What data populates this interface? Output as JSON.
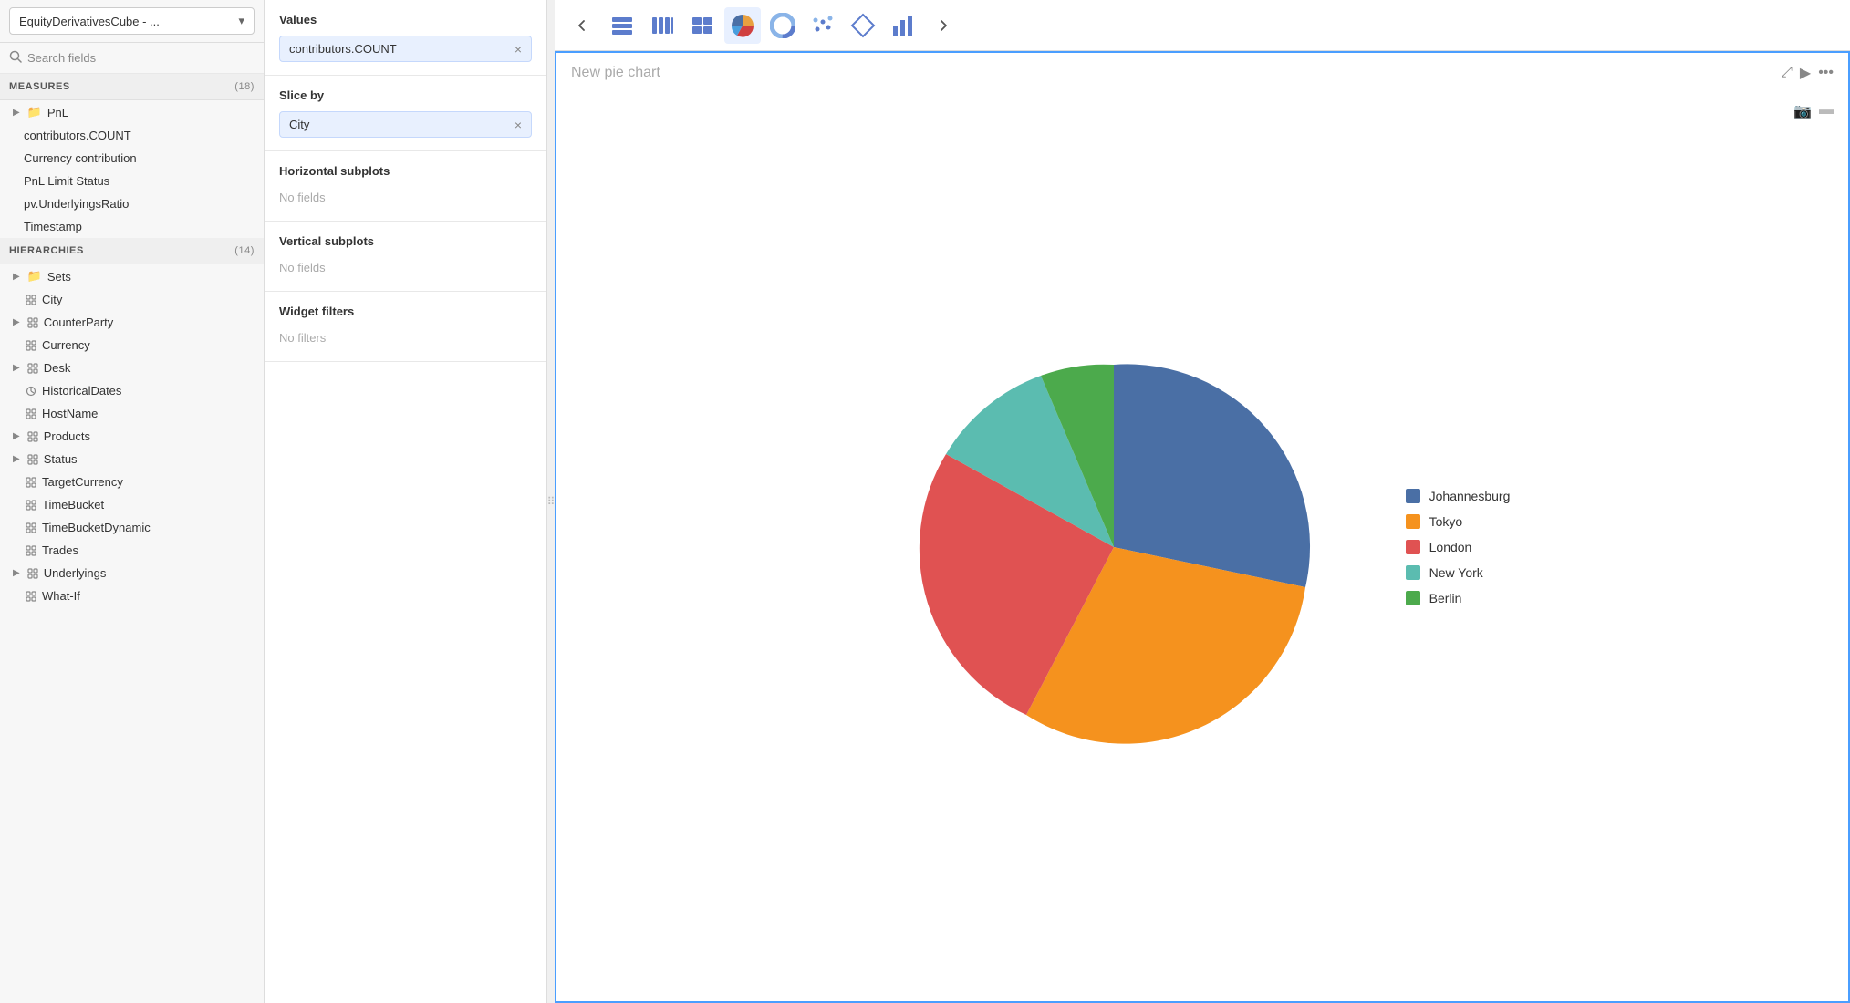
{
  "cube": {
    "name": "EquityDerivativesCube - ...",
    "dropdown_label": "EquityDerivativesCube - ..."
  },
  "search": {
    "placeholder": "Search fields",
    "label": "Search fields"
  },
  "measures": {
    "label": "MEASURES",
    "count": "(18)",
    "items": [
      {
        "id": "pnl",
        "label": "PnL",
        "type": "folder",
        "expandable": true
      },
      {
        "id": "contributors_count",
        "label": "contributors.COUNT",
        "type": "measure",
        "expandable": false
      },
      {
        "id": "currency_contribution",
        "label": "Currency contribution",
        "type": "measure",
        "expandable": false
      },
      {
        "id": "pnl_limit_status",
        "label": "PnL Limit Status",
        "type": "measure",
        "expandable": false
      },
      {
        "id": "pv_underlyings_ratio",
        "label": "pv.UnderlyingsRatio",
        "type": "measure",
        "expandable": false
      },
      {
        "id": "timestamp",
        "label": "Timestamp",
        "type": "measure",
        "expandable": false
      }
    ]
  },
  "hierarchies": {
    "label": "HIERARCHIES",
    "count": "(14)",
    "items": [
      {
        "id": "sets",
        "label": "Sets",
        "type": "folder",
        "expandable": true,
        "indent": false
      },
      {
        "id": "city",
        "label": "City",
        "type": "hierarchy",
        "expandable": false,
        "indent": false
      },
      {
        "id": "counterparty",
        "label": "CounterParty",
        "type": "hierarchy",
        "expandable": true,
        "indent": false
      },
      {
        "id": "currency",
        "label": "Currency",
        "type": "hierarchy",
        "expandable": false,
        "indent": false
      },
      {
        "id": "desk",
        "label": "Desk",
        "type": "hierarchy",
        "expandable": true,
        "indent": false
      },
      {
        "id": "historical_dates",
        "label": "HistoricalDates",
        "type": "hierarchy_special",
        "expandable": false,
        "indent": false
      },
      {
        "id": "hostname",
        "label": "HostName",
        "type": "hierarchy",
        "expandable": false,
        "indent": false
      },
      {
        "id": "products",
        "label": "Products",
        "type": "hierarchy",
        "expandable": true,
        "indent": false
      },
      {
        "id": "status",
        "label": "Status",
        "type": "hierarchy",
        "expandable": true,
        "indent": false
      },
      {
        "id": "target_currency",
        "label": "TargetCurrency",
        "type": "hierarchy",
        "expandable": false,
        "indent": false
      },
      {
        "id": "time_bucket",
        "label": "TimeBucket",
        "type": "hierarchy",
        "expandable": false,
        "indent": false
      },
      {
        "id": "time_bucket_dynamic",
        "label": "TimeBucketDynamic",
        "type": "hierarchy",
        "expandable": false,
        "indent": false
      },
      {
        "id": "trades",
        "label": "Trades",
        "type": "hierarchy",
        "expandable": false,
        "indent": false
      },
      {
        "id": "underlyings",
        "label": "Underlyings",
        "type": "hierarchy",
        "expandable": true,
        "indent": false
      },
      {
        "id": "what_if",
        "label": "What-If",
        "type": "hierarchy",
        "expandable": false,
        "indent": false
      }
    ]
  },
  "middle_panel": {
    "values_section": {
      "title": "Values",
      "field": "contributors.COUNT",
      "close_label": "×"
    },
    "slice_by_section": {
      "title": "Slice by",
      "field": "City",
      "close_label": "×"
    },
    "horizontal_subplots": {
      "title": "Horizontal subplots",
      "empty_label": "No fields"
    },
    "vertical_subplots": {
      "title": "Vertical subplots",
      "empty_label": "No fields"
    },
    "widget_filters": {
      "title": "Widget filters",
      "empty_label": "No filters"
    }
  },
  "toolbar": {
    "nav_back": "‹",
    "nav_forward": "›",
    "chart_types": [
      "table-rows",
      "table-cols",
      "table-cross",
      "pie",
      "donut",
      "scatter",
      "diamond",
      "bar",
      "more"
    ]
  },
  "chart": {
    "title": "New pie chart",
    "legend": [
      {
        "label": "Johannesburg",
        "color": "#4a6fa5"
      },
      {
        "label": "Tokyo",
        "color": "#f5921e"
      },
      {
        "label": "London",
        "color": "#e05252"
      },
      {
        "label": "New York",
        "color": "#5bbcb0"
      },
      {
        "label": "Berlin",
        "color": "#4caa4c"
      }
    ],
    "slices": [
      {
        "label": "Johannesburg",
        "percentage": 32,
        "color": "#4a6fa5",
        "startAngle": 0,
        "endAngle": 115
      },
      {
        "label": "Tokyo",
        "percentage": 28,
        "color": "#f5921e",
        "startAngle": 115,
        "endAngle": 215
      },
      {
        "label": "London",
        "percentage": 20,
        "color": "#e05252",
        "startAngle": 215,
        "endAngle": 287
      },
      {
        "label": "New York",
        "percentage": 14,
        "color": "#5bbcb0",
        "startAngle": 287,
        "endAngle": 338
      },
      {
        "label": "Berlin",
        "percentage": 6,
        "color": "#4caa4c",
        "startAngle": 338,
        "endAngle": 360
      }
    ]
  }
}
